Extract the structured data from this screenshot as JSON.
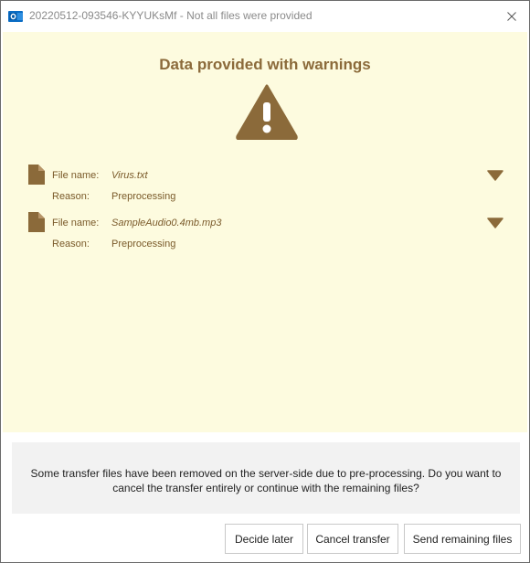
{
  "window": {
    "title": "20220512-093546-KYYUKsMf - Not all files were provided",
    "app_icon": "outlook-icon",
    "close_icon": "close-icon"
  },
  "warning": {
    "heading": "Data provided with warnings",
    "icon": "warning-triangle-icon",
    "accent_color": "#8b6a3a",
    "panel_color": "#fdfbdf"
  },
  "files": [
    {
      "name_label": "File name:",
      "name": "Virus.txt",
      "reason_label": "Reason:",
      "reason": "Preprocessing"
    },
    {
      "name_label": "File name:",
      "name": "SampleAudio0.4mb.mp3",
      "reason_label": "Reason:",
      "reason": "Preprocessing"
    }
  ],
  "message": "Some transfer files have been removed on the server-side due to pre-processing. Do you want to cancel the transfer entirely or continue with the remaining files?",
  "buttons": {
    "decide_later": "Decide later",
    "cancel_transfer": "Cancel transfer",
    "send_remaining": "Send remaining files"
  }
}
